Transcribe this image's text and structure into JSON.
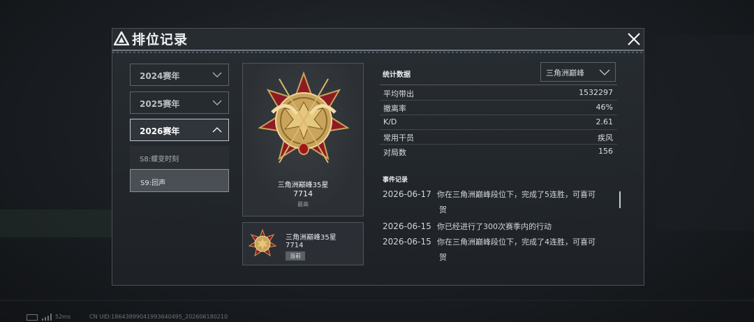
{
  "window": {
    "title": "排位记录"
  },
  "seasons": {
    "years": [
      {
        "label": "2024赛年",
        "expanded": false
      },
      {
        "label": "2025赛年",
        "expanded": false
      },
      {
        "label": "2026赛年",
        "expanded": true
      }
    ],
    "items": [
      {
        "label": "S8:蝶变时刻",
        "selected": false
      },
      {
        "label": "S9:回声",
        "selected": true
      }
    ]
  },
  "highest_rank": {
    "name": "三角洲巅峰35星",
    "score": "7714",
    "tag": "最高"
  },
  "current_rank": {
    "name": "三角洲巅峰35星",
    "score": "7714",
    "tag": "当前"
  },
  "stats": {
    "title": "统计数据",
    "filter_value": "三角洲巅峰",
    "rows": [
      {
        "label": "平均带出",
        "value": "1532297"
      },
      {
        "label": "撤离率",
        "value": "46%"
      },
      {
        "label": "K/D",
        "value": "2.61"
      },
      {
        "label": "常用干员",
        "value": "疾风"
      },
      {
        "label": "对局数",
        "value": "156"
      }
    ]
  },
  "events": {
    "title": "事件记录",
    "items": [
      {
        "date": "2026-06-17",
        "text": "你在三角洲巅峰段位下，完成了5连胜，可喜可",
        "cont": "贺"
      },
      {
        "date": "2026-06-15",
        "text": "你已经进行了300次赛季内的行动",
        "cont": ""
      },
      {
        "date": "2026-06-15",
        "text": "你在三角洲巅峰段位下，完成了4连胜，可喜可",
        "cont": "贺"
      }
    ]
  },
  "status_bar": {
    "ping": "52ms",
    "uid": "CN UID:18643899041993640495_202606180210"
  },
  "colors": {
    "accent": "#c2c8cd",
    "medal_red": "#8e1b24",
    "medal_gold": "#c9a45a"
  }
}
